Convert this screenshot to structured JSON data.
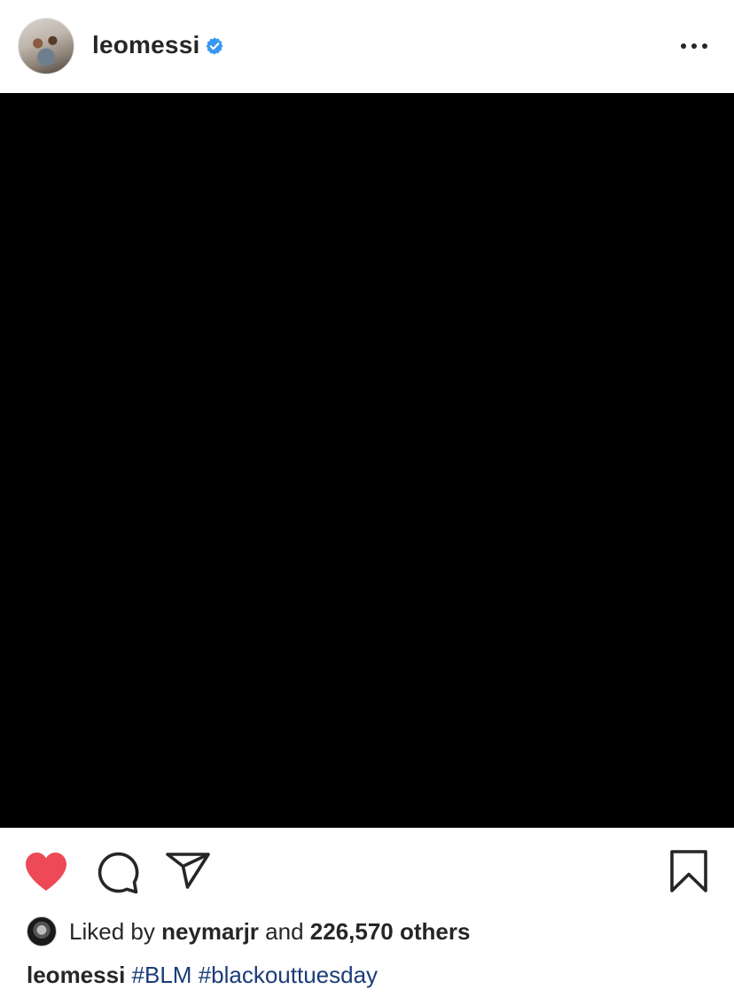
{
  "post": {
    "username": "leomessi",
    "verified": true,
    "likes": {
      "prefix": "Liked by",
      "liker": "neymarjr",
      "conjunction": "and",
      "count": "226,570 others"
    },
    "caption": {
      "username": "leomessi",
      "hashtags": [
        "#BLM",
        "#blackouttuesday"
      ]
    }
  },
  "colors": {
    "like_heart": "#ed4956",
    "verified_badge": "#3897f0",
    "hashtag": "#1b3c78",
    "photo_background": "#000000"
  },
  "icons": {
    "more": "more-options-icon",
    "like": "heart-icon",
    "comment": "comment-icon",
    "share": "direct-share-icon",
    "save": "bookmark-icon"
  }
}
